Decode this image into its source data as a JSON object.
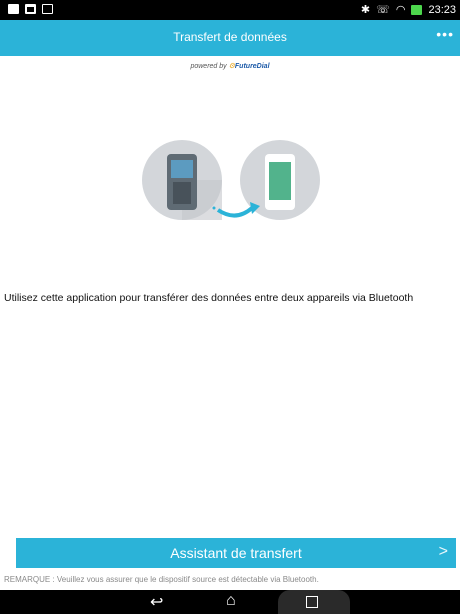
{
  "status_bar": {
    "time": "23:23",
    "left_icons": [
      "notification-icon",
      "image-icon",
      "gallery-icon"
    ],
    "right_icons": [
      "bluetooth-icon",
      "phone-icon",
      "wifi-icon",
      "battery-icon"
    ]
  },
  "app_bar": {
    "title": "Transfert de données",
    "more_icon": "more-icon"
  },
  "powered_by": {
    "prefix": "powered by",
    "brand": "FutureDial"
  },
  "illustration": {
    "source_device": "feature-phone-icon",
    "target_device": "smartphone-icon",
    "arrow": "transfer-arrow-icon"
  },
  "description": "Utilisez cette application pour transférer des données entre deux appareils via Bluetooth",
  "assistant_button": {
    "label": "Assistant de transfert",
    "chevron": ">"
  },
  "note": "REMARQUE : Veuillez vous assurer que le dispositif source est détectable via Bluetooth.",
  "nav_bar": {
    "back_icon": "back-icon",
    "home_icon": "home-icon",
    "recent_icon": "recent-apps-icon"
  },
  "colors": {
    "accent": "#2bb3d8",
    "status_bar": "#000000"
  }
}
